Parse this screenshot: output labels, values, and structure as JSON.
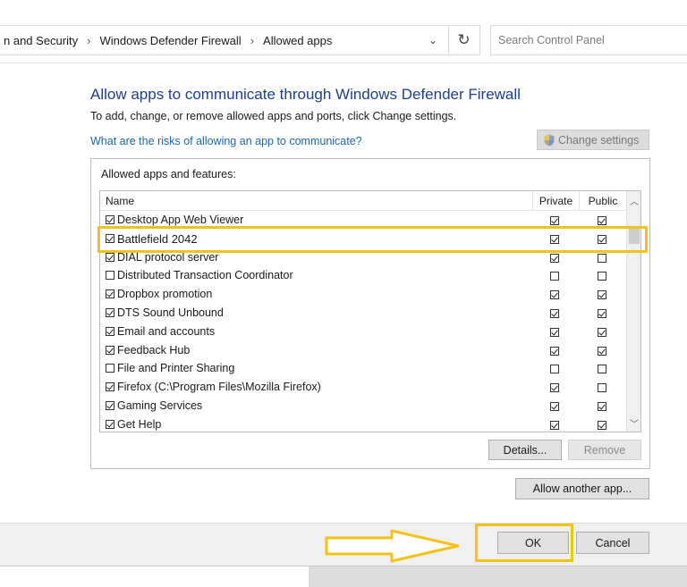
{
  "address_bar": {
    "breadcrumbs": [
      "n and Security",
      "Windows Defender Firewall",
      "Allowed apps"
    ],
    "dropdown_glyph": "⌄",
    "refresh_glyph": "↻"
  },
  "search": {
    "placeholder": "Search Control Panel"
  },
  "page": {
    "title": "Allow apps to communicate through Windows Defender Firewall",
    "subtitle": "To add, change, or remove allowed apps and ports, click Change settings.",
    "risk_link": "What are the risks of allowing an app to communicate?",
    "change_settings_label": "Change settings"
  },
  "apps_group": {
    "label": "Allowed apps and features:",
    "columns": {
      "name": "Name",
      "private": "Private",
      "public": "Public"
    },
    "rows": [
      {
        "name": "Desktop App Web Viewer",
        "enabled": true,
        "private": true,
        "public": true
      },
      {
        "name": "Battlefield 2042",
        "enabled": true,
        "private": true,
        "public": true
      },
      {
        "name": "DIAL protocol server",
        "enabled": true,
        "private": true,
        "public": false
      },
      {
        "name": "Distributed Transaction Coordinator",
        "enabled": false,
        "private": false,
        "public": false
      },
      {
        "name": "Dropbox promotion",
        "enabled": true,
        "private": true,
        "public": true
      },
      {
        "name": "DTS Sound Unbound",
        "enabled": true,
        "private": true,
        "public": true
      },
      {
        "name": "Email and accounts",
        "enabled": true,
        "private": true,
        "public": true
      },
      {
        "name": "Feedback Hub",
        "enabled": true,
        "private": true,
        "public": true
      },
      {
        "name": "File and Printer Sharing",
        "enabled": false,
        "private": false,
        "public": false
      },
      {
        "name": "Firefox (C:\\Program Files\\Mozilla Firefox)",
        "enabled": true,
        "private": true,
        "public": false
      },
      {
        "name": "Gaming Services",
        "enabled": true,
        "private": true,
        "public": true
      },
      {
        "name": "Get Help",
        "enabled": true,
        "private": true,
        "public": true
      }
    ],
    "details_label": "Details...",
    "remove_label": "Remove"
  },
  "allow_another_label": "Allow another app...",
  "footer": {
    "ok_label": "OK",
    "cancel_label": "Cancel"
  },
  "highlight_color": "#f2c216"
}
